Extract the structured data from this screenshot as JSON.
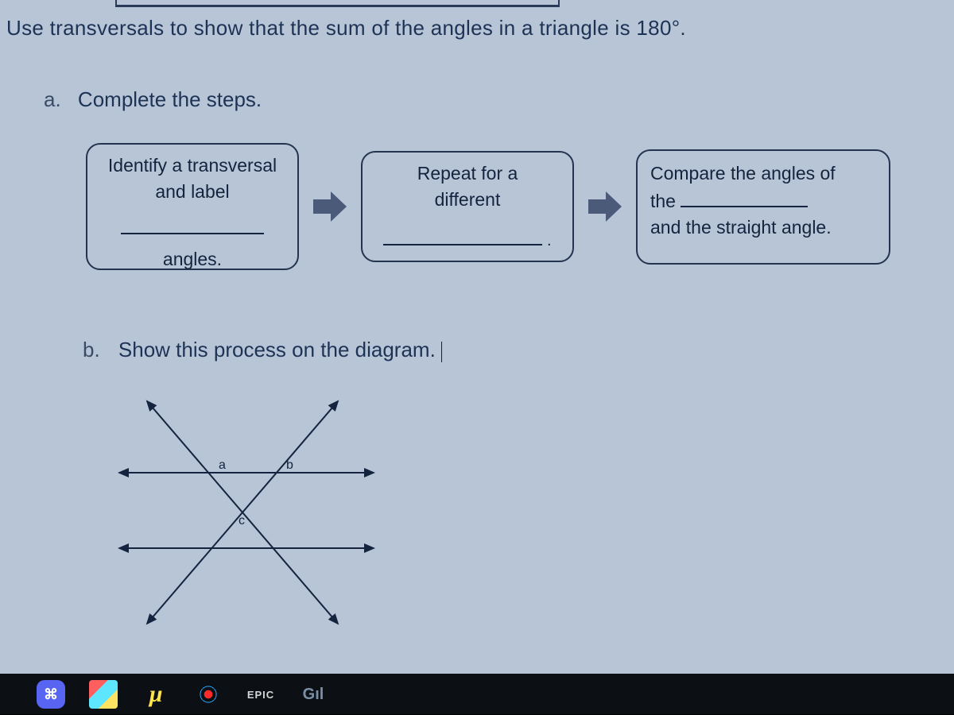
{
  "intro_text": "Use transversals to show that the sum of the angles in a triangle is 180°.",
  "part_a": {
    "letter": "a.",
    "prompt": "Complete the steps."
  },
  "steps": {
    "s1": {
      "line1": "Identify a transversal",
      "line2": "and label",
      "line3": "angles."
    },
    "s2": {
      "line1": "Repeat for a",
      "line2": "different"
    },
    "s3": {
      "line1": "Compare the angles of",
      "line2a": "the",
      "line3": "and the straight angle."
    }
  },
  "part_b": {
    "letter": "b.",
    "prompt": "Show this process on the diagram."
  },
  "diagram": {
    "label_a": "a",
    "label_b": "b",
    "label_c": "c"
  },
  "taskbar": {
    "discord_glyph": "⌘",
    "mu_glyph": "µ",
    "epic_label": "EPIC",
    "gil_label": "Gıl"
  }
}
